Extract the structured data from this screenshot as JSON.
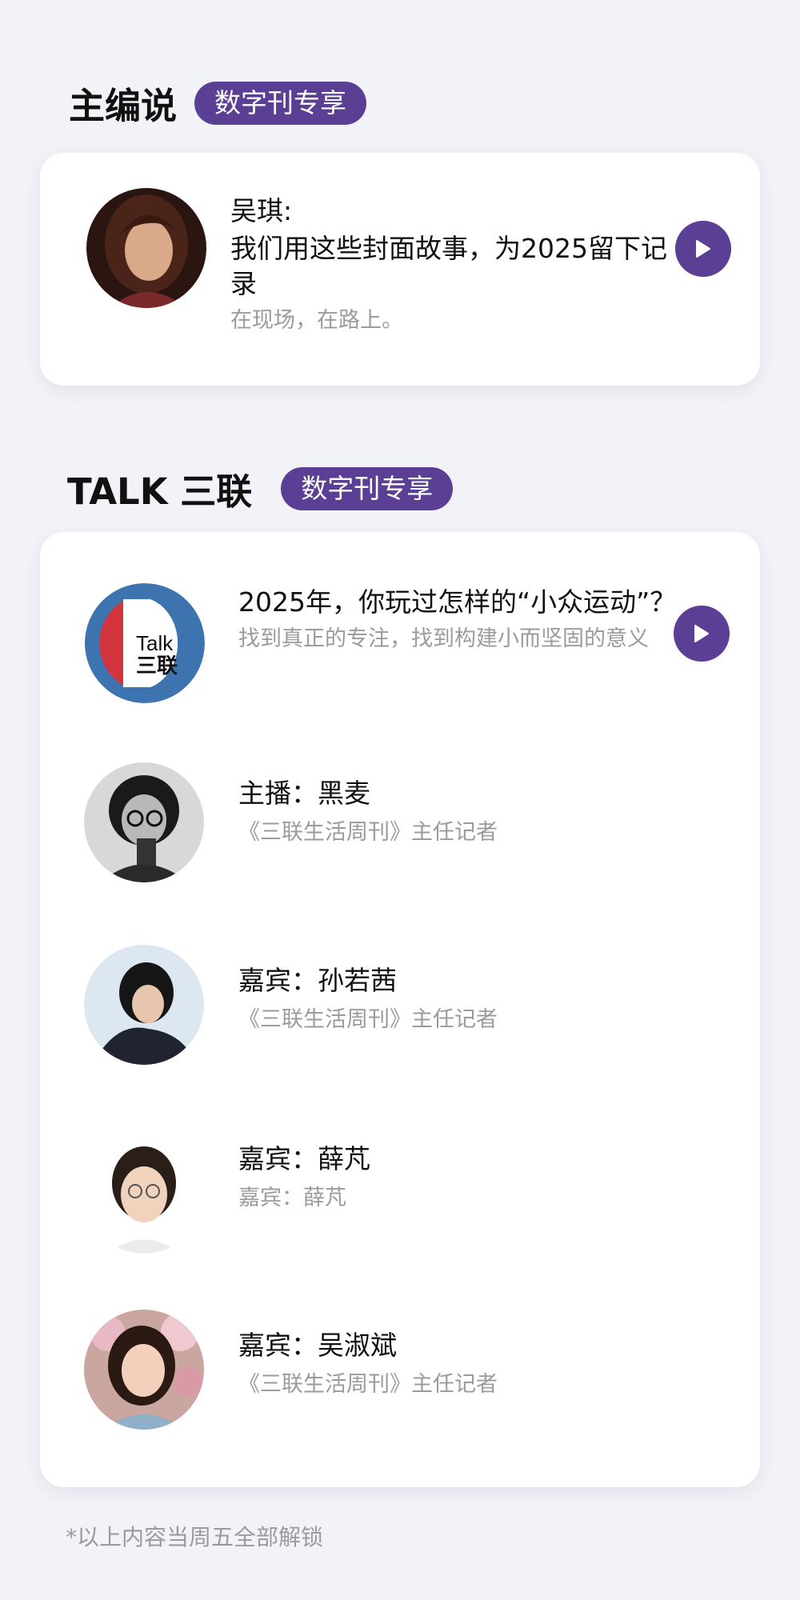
{
  "editor_section": {
    "title": "主编说",
    "badge": "数字刊专享",
    "item": {
      "name": "吴琪:",
      "title": "我们用这些封面故事，为2025留下记录",
      "subtitle": "在现场，在路上。"
    }
  },
  "talk_section": {
    "title": "TALK 三联",
    "badge": "数字刊专享",
    "episode": {
      "logo_text_top": "Talk",
      "logo_text_bottom": "三联",
      "title": "2025年，你玩过怎样的“小众运动”？",
      "subtitle": "找到真正的专注，找到构建小而坚固的意义"
    },
    "people": [
      {
        "name": "主播：黑麦",
        "role": "《三联生活周刊》主任记者"
      },
      {
        "name": "嘉宾：孙若茜",
        "role": "《三联生活周刊》主任记者"
      },
      {
        "name": "嘉宾：薛芃",
        "role": "嘉宾：薛芃"
      },
      {
        "name": "嘉宾：吴淑斌",
        "role": "《三联生活周刊》主任记者"
      }
    ]
  },
  "footnote": "*以上内容当周五全部解锁",
  "colors": {
    "accent": "#5b3f95",
    "background": "#f2f3f8",
    "muted_text": "#9b9b9b",
    "talk_logo_blue": "#3d74b0",
    "talk_logo_red": "#d2343e"
  },
  "icons": {
    "play": "play-icon"
  }
}
